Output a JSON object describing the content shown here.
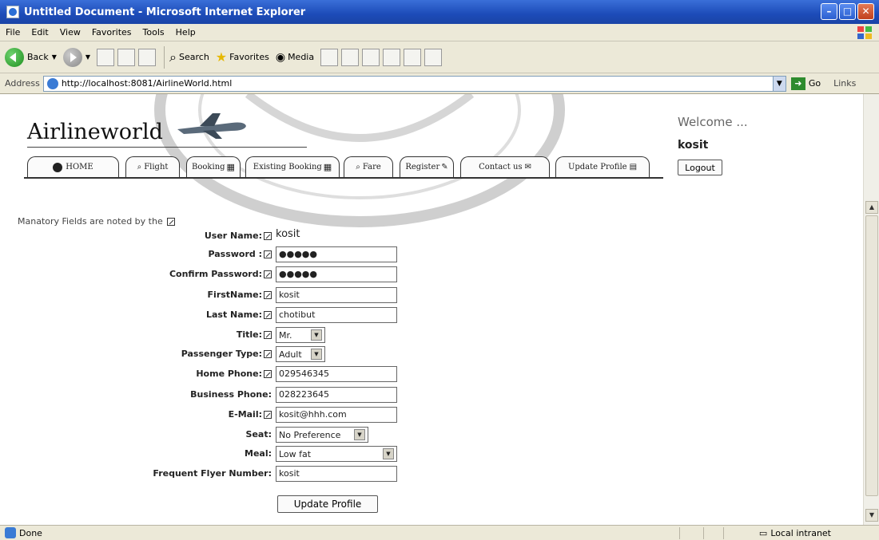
{
  "window": {
    "title": "Untitled Document - Microsoft Internet Explorer"
  },
  "menu": [
    "File",
    "Edit",
    "View",
    "Favorites",
    "Tools",
    "Help"
  ],
  "toolbar": {
    "back": "Back",
    "search": "Search",
    "favorites": "Favorites",
    "media": "Media"
  },
  "address": {
    "label": "Address",
    "url": "http://localhost:8081/AirlineWorld.html",
    "go": "Go",
    "links": "Links"
  },
  "site": {
    "logo": "Airlineworld",
    "welcome": "Welcome ...",
    "user": "kosit",
    "logout": "Logout",
    "nav": [
      "HOME",
      "Flight",
      "Booking",
      "Existing Booking",
      "Fare",
      "Register",
      "Contact us",
      "Update Profile"
    ]
  },
  "form": {
    "note": "Manatory Fields are noted by the",
    "fields": {
      "username": {
        "label": "User Name:",
        "value": "kosit"
      },
      "password": {
        "label": "Password :",
        "value": "●●●●●"
      },
      "confirm": {
        "label": "Confirm Password:",
        "value": "●●●●●"
      },
      "firstname": {
        "label": "FirstName:",
        "value": "kosit"
      },
      "lastname": {
        "label": "Last Name:",
        "value": "chotibut"
      },
      "title": {
        "label": "Title:",
        "value": "Mr."
      },
      "ptype": {
        "label": "Passenger Type:",
        "value": "Adult"
      },
      "homephone": {
        "label": "Home Phone:",
        "value": "029546345"
      },
      "bizphone": {
        "label": "Business Phone:",
        "value": "028223645"
      },
      "email": {
        "label": "E-Mail:",
        "value": "kosit@hhh.com"
      },
      "seat": {
        "label": "Seat:",
        "value": "No Preference"
      },
      "meal": {
        "label": "Meal:",
        "value": "Low fat"
      },
      "ffn": {
        "label": "Frequent Flyer Number:",
        "value": "kosit"
      }
    },
    "submit": "Update Profile"
  },
  "status": {
    "left": "Done",
    "right": "Local intranet"
  }
}
